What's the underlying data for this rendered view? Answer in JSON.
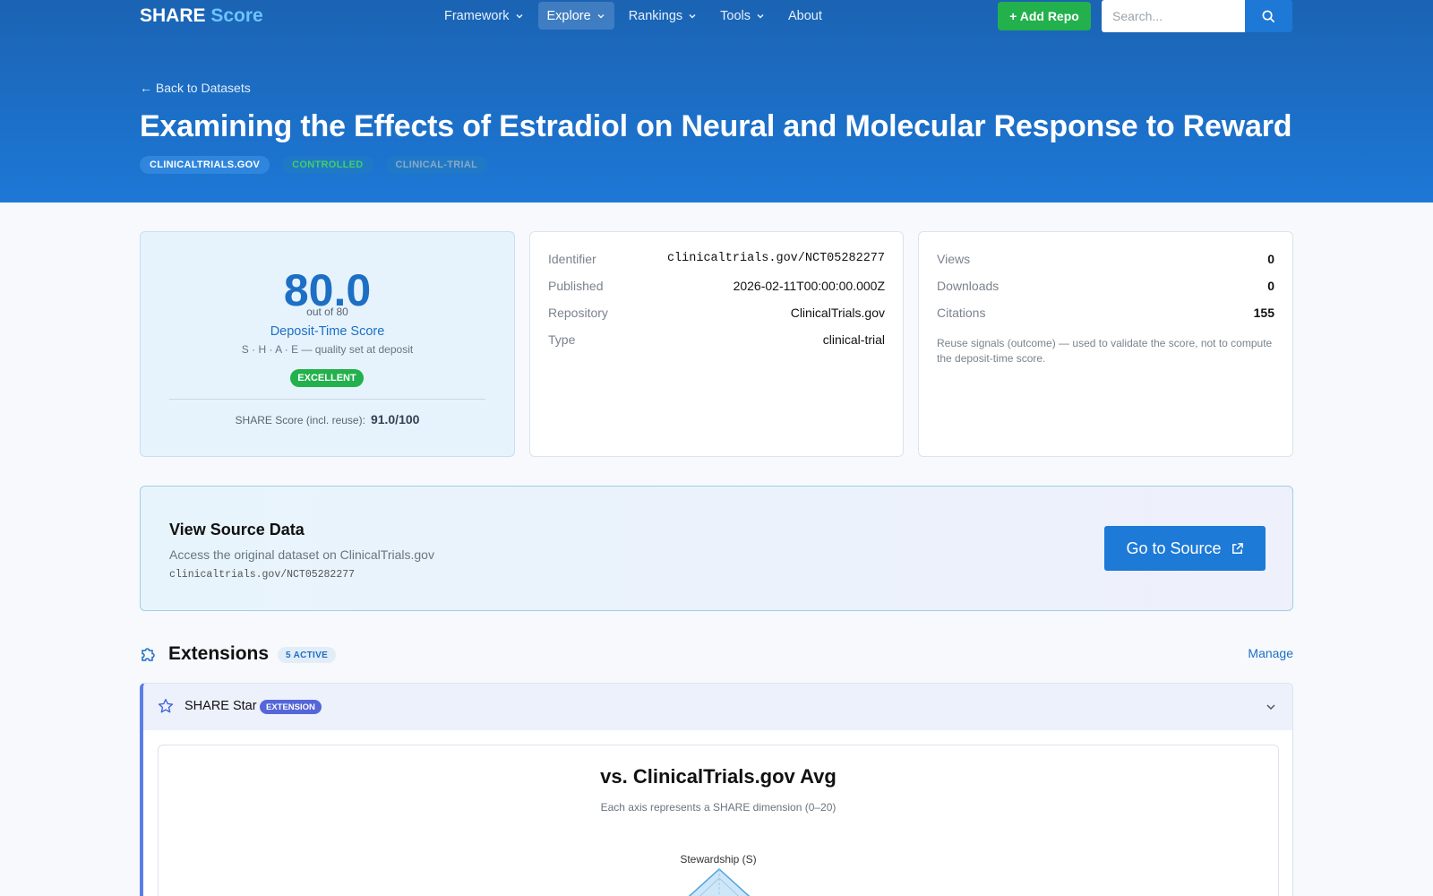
{
  "nav": {
    "brand_main": "SHARE",
    "brand_accent": "Score",
    "items": [
      {
        "label": "Framework"
      },
      {
        "label": "Explore"
      },
      {
        "label": "Rankings"
      },
      {
        "label": "Tools"
      },
      {
        "label": "About"
      }
    ],
    "add_repo": "+ Add Repo",
    "search_placeholder": "Search..."
  },
  "hero": {
    "back": "← Back to Datasets",
    "title": "Examining the Effects of Estradiol on Neural and Molecular Response to Reward",
    "tags": [
      "CLINICALTRIALS.GOV",
      "CONTROLLED",
      "CLINICAL-TRIAL"
    ]
  },
  "score": {
    "value": "80.0",
    "out_of": "out of 80",
    "label": "Deposit-Time Score",
    "sub": "S · H · A · E — quality set at deposit",
    "badge": "EXCELLENT",
    "reuse_label": "SHARE Score (incl. reuse):",
    "reuse_value": "91.0/100"
  },
  "meta": {
    "identifier_label": "Identifier",
    "identifier": "clinicaltrials.gov/NCT05282277",
    "published_label": "Published",
    "published": "2026-02-11T00:00:00.000Z",
    "repository_label": "Repository",
    "repository": "ClinicalTrials.gov",
    "type_label": "Type",
    "type": "clinical-trial"
  },
  "reuse": {
    "views_label": "Views",
    "views": "0",
    "downloads_label": "Downloads",
    "downloads": "0",
    "citations_label": "Citations",
    "citations": "155",
    "note": "Reuse signals (outcome) — used to validate the score, not to compute the deposit-time score."
  },
  "source": {
    "title": "View Source Data",
    "desc": "Access the original dataset on ClinicalTrials.gov",
    "id": "clinicaltrials.gov/NCT05282277",
    "button": "Go to Source"
  },
  "extensions": {
    "title": "Extensions",
    "count": "5 ACTIVE",
    "manage": "Manage",
    "panel": {
      "name": "SHARE Star",
      "type": "EXTENSION",
      "chart_title": "vs. ClinicalTrials.gov Avg",
      "chart_sub": "Each axis represents a SHARE dimension (0–20)",
      "axis_top": "Stewardship (S)"
    }
  },
  "colors": {
    "primary": "#1d78d6",
    "success": "#22b14c",
    "extension": "#5566d8"
  }
}
